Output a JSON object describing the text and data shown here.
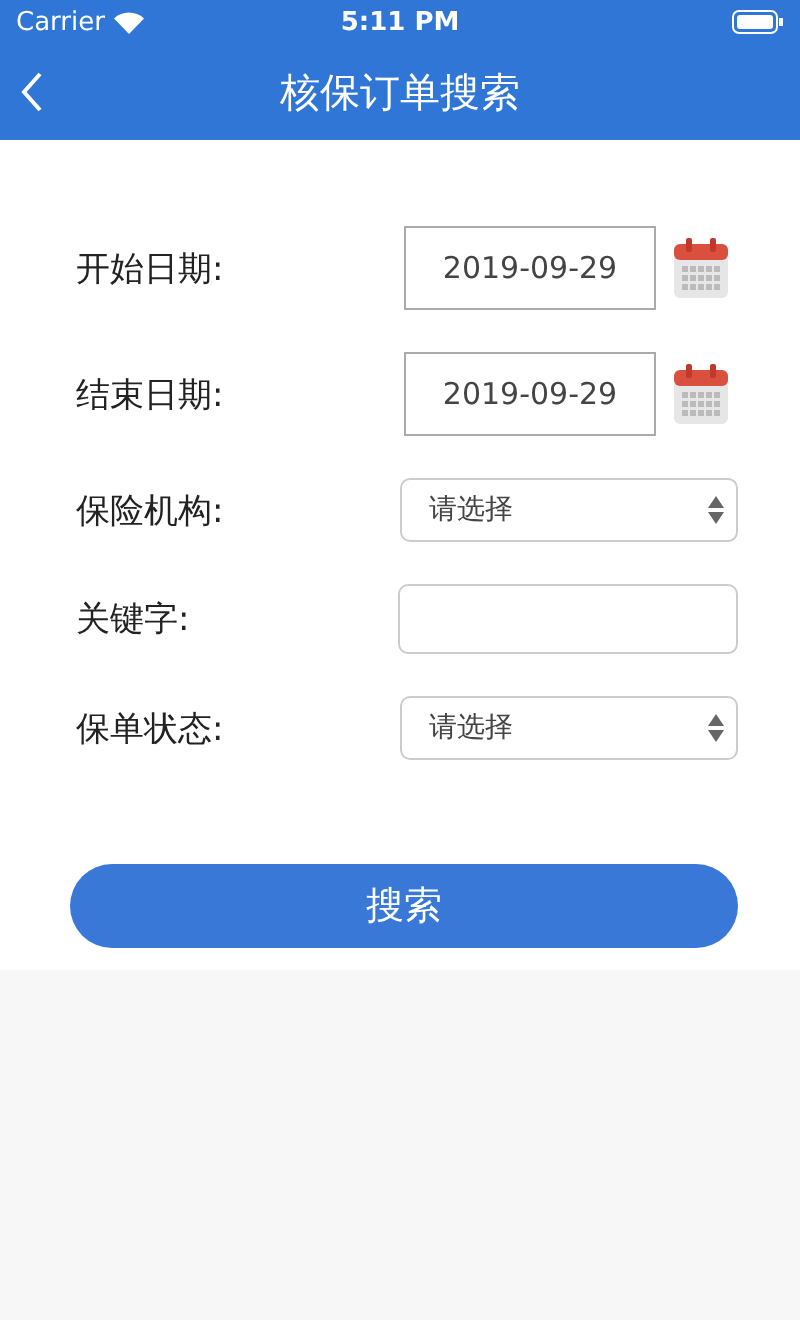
{
  "status_bar": {
    "carrier": "Carrier",
    "time": "5:11 PM"
  },
  "nav_bar": {
    "title": "核保订单搜索"
  },
  "fields": [
    {
      "kind": "date",
      "label": "开始日期:",
      "value": "2019-09-29"
    },
    {
      "kind": "date",
      "label": "结束日期:",
      "value": "2019-09-29"
    },
    {
      "kind": "select",
      "label": "保险机构:",
      "value": "请选择"
    },
    {
      "kind": "text",
      "label": "关键字:"
    },
    {
      "kind": "select",
      "label": "保单状态:",
      "value": "请选择"
    }
  ],
  "search_button": "搜索"
}
